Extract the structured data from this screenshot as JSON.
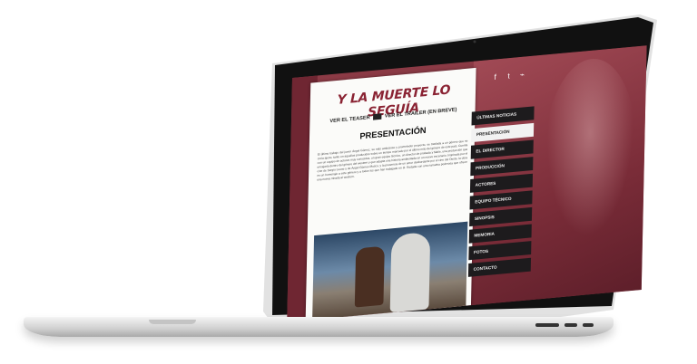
{
  "site": {
    "title": "Y LA MUERTE LO SEGUÍA",
    "teaser_link": "VER EL TEASER",
    "trailer_link": "VER EL TRAILER (EN BREVE)",
    "section_title": "PRESENTACIÓN",
    "body": "El último trabajo del joven Ángel Gómez, su más ambicioso y prometedor proyecto, se traslada a un género que se creía ajeno, tanto en aquellos producidos sobre un tiempo marcado por el último mito del género de este país. Cuenta con un equipo de actores muy conocidos, un gran equipo técnico, un director de probada y fiable, una producción que encajaría dentro del género del western y que adapta una historia ambientada en un nuevo escenario. Inspirada por el cine de Sergio Leone y de Ángel Gómez-Mosco, y la presencia de un amor desbordante por el cine del Oeste, la obra es un homenaje a este género y a todos los que han trabajado en él. Rodada con una narrativa poderosa que ofrece una nueva mirada al western.",
    "social_icons": [
      "facebook-icon",
      "twitter-icon",
      "rss-icon"
    ],
    "social_glyphs": [
      "f",
      "t",
      "⌁"
    ],
    "menu": [
      {
        "label": "ÚLTIMAS NOTICIAS",
        "active": false
      },
      {
        "label": "PRESENTACIÓN",
        "active": true
      },
      {
        "label": "EL DIRECTOR",
        "active": false
      },
      {
        "label": "PRODUCCIÓN",
        "active": false
      },
      {
        "label": "ACTORES",
        "active": false
      },
      {
        "label": "EQUIPO TÉCNICO",
        "active": false
      },
      {
        "label": "SINOPSIS",
        "active": false
      },
      {
        "label": "MEMORIA",
        "active": false
      },
      {
        "label": "FOTOS",
        "active": false
      },
      {
        "label": "CONTACTO",
        "active": false
      }
    ]
  },
  "colors": {
    "accent": "#8a2333",
    "background": "#8b3a45",
    "menu_bg": "#1d1b1d"
  }
}
